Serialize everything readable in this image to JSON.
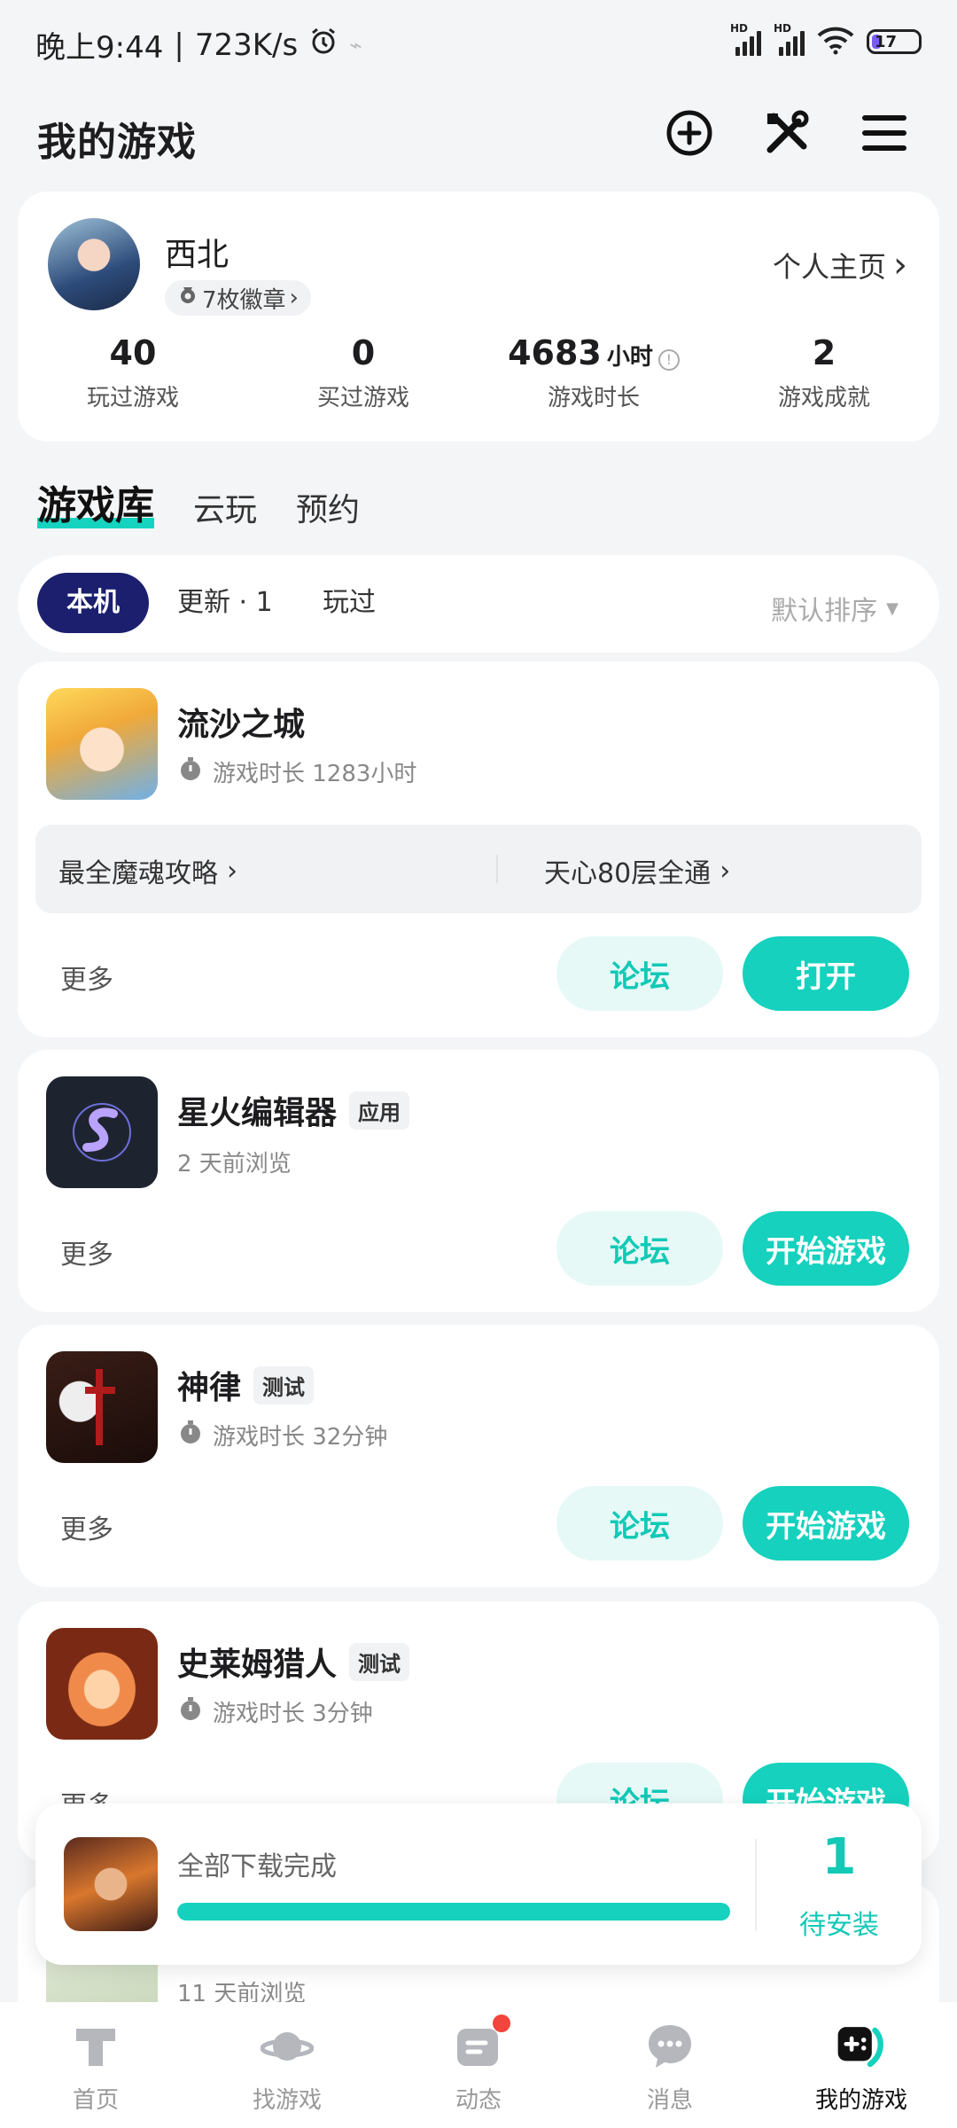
{
  "status_bar": {
    "time": "晚上9:44",
    "speed": "723K/s",
    "battery": "17",
    "signal_label": "HD"
  },
  "header": {
    "title": "我的游戏",
    "icons": [
      "add-circle-icon",
      "tools-icon",
      "menu-icon"
    ]
  },
  "profile": {
    "username": "西北",
    "badges": "7枚徽章",
    "homepage_link": "个人主页",
    "stats": [
      {
        "value": "40",
        "label": "玩过游戏"
      },
      {
        "value": "0",
        "label": "买过游戏"
      },
      {
        "value": "4683",
        "unit": "小时",
        "label": "游戏时长"
      },
      {
        "value": "2",
        "label": "游戏成就"
      }
    ]
  },
  "tabs": [
    "游戏库",
    "云玩",
    "预约"
  ],
  "filters": {
    "chips": [
      "本机",
      "更新 · 1",
      "玩过"
    ],
    "sort": "默认排序"
  },
  "games": [
    {
      "title": "流沙之城",
      "tag": "",
      "subtitle": "游戏时长 1283小时",
      "guides": [
        "最全魔魂攻略",
        "天心80层全通"
      ],
      "more": "更多",
      "forum_label": "论坛",
      "action_label": "打开"
    },
    {
      "title": "星火编辑器",
      "tag": "应用",
      "subtitle": "2 天前浏览",
      "more": "更多",
      "forum_label": "论坛",
      "action_label": "开始游戏"
    },
    {
      "title": "神律",
      "tag": "测试",
      "subtitle": "游戏时长 32分钟",
      "more": "更多",
      "forum_label": "论坛",
      "action_label": "开始游戏"
    },
    {
      "title": "史莱姆猎人",
      "tag": "测试",
      "subtitle": "游戏时长 3分钟",
      "more": "更多",
      "forum_label": "论坛",
      "action_label": "开始游戏"
    },
    {
      "subtitle": "11 天前浏览"
    }
  ],
  "download_banner": {
    "text": "全部下载完成",
    "progress": 1.0,
    "count": "1",
    "count_label": "待安装"
  },
  "bottom_nav": [
    {
      "label": "首页",
      "icon": "home-icon"
    },
    {
      "label": "找游戏",
      "icon": "planet-icon"
    },
    {
      "label": "动态",
      "icon": "feed-icon"
    },
    {
      "label": "消息",
      "icon": "chat-icon"
    },
    {
      "label": "我的游戏",
      "icon": "gamepad-icon"
    }
  ],
  "colors": {
    "accent": "#15d1bd",
    "chip_active": "#1b1f6e",
    "notification": "#f2453d"
  }
}
